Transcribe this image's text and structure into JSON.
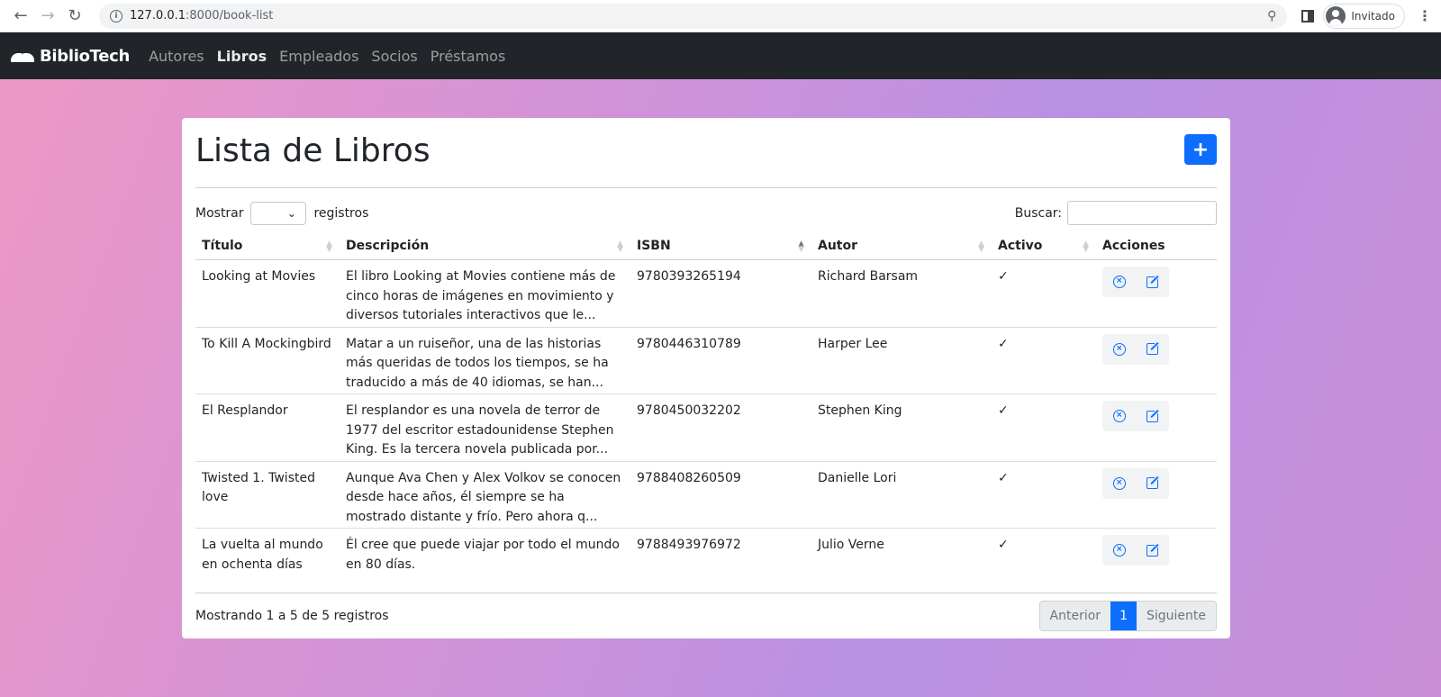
{
  "browser": {
    "url_host": "127.0.0.1",
    "url_path": ":8000/book-list",
    "profile_label": "Invitado"
  },
  "navbar": {
    "brand": "BiblioTech",
    "links": [
      "Autores",
      "Libros",
      "Empleados",
      "Socios",
      "Préstamos"
    ],
    "active": "Libros"
  },
  "main": {
    "title": "Lista de Libros",
    "add_label": "+",
    "length_prefix": "Mostrar",
    "length_suffix": "registros",
    "search_label": "Buscar:",
    "columns": [
      "Título",
      "Descripción",
      "ISBN",
      "Autor",
      "Activo",
      "Acciones"
    ],
    "rows": [
      {
        "title": "Looking at Movies",
        "description": "El libro Looking at Movies contiene más de cinco horas de imágenes en movimiento y diversos tutoriales interactivos que le...",
        "isbn": "9780393265194",
        "author": "Richard Barsam",
        "active": "✓"
      },
      {
        "title": "To Kill A Mockingbird",
        "description": "Matar a un ruiseñor, una de las historias más queridas de todos los tiempos, se ha traducido a más de 40 idiomas, se han...",
        "isbn": "9780446310789",
        "author": "Harper Lee",
        "active": "✓"
      },
      {
        "title": "El Resplandor",
        "description": "El resplandor es una novela de terror de 1977 del escritor estadounidense Stephen King. Es la tercera novela publicada por...",
        "isbn": "9780450032202",
        "author": "Stephen King",
        "active": "✓"
      },
      {
        "title": "Twisted 1. Twisted love",
        "description": "Aunque Ava Chen y Alex Volkov se conocen desde hace años, él siempre se ha mostrado distante y frío. Pero ahora q...",
        "isbn": "9788408260509",
        "author": "Danielle Lori",
        "active": "✓"
      },
      {
        "title": "La vuelta al mundo en ochenta días",
        "description": "Él cree que puede viajar por todo el mundo en 80 días.",
        "isbn": "9788493976972",
        "author": "Julio Verne",
        "active": "✓"
      }
    ],
    "info": "Mostrando 1 a 5 de 5 registros",
    "pagination": {
      "prev": "Anterior",
      "current": "1",
      "next": "Siguiente"
    }
  },
  "colors": {
    "primary": "#0d6efd",
    "navbar_bg": "#212529"
  }
}
